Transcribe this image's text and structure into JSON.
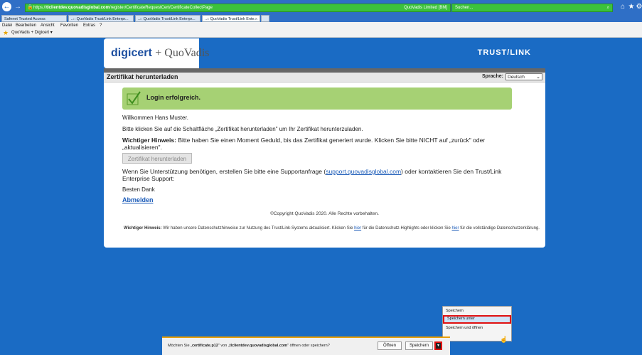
{
  "browser": {
    "url_prefix": "https://",
    "url_domain": "tlclientdev.quovadisglobal.com",
    "url_path": "/register/CertificateRequestCert/CertificateCollectPage",
    "cert_label": "QuoVadis Limited [BM]",
    "search_placeholder": "Suchen...",
    "tabs": [
      {
        "label": "Safenet Trusted Access"
      },
      {
        "label": "..:: QuoVadis Trust/Link Enterpr..."
      },
      {
        "label": "..:: QuoVadis Trust/Link Enterpr..."
      },
      {
        "label": "..:: QuoVadis Trust/Link Ente..."
      }
    ],
    "menu": [
      "Datei",
      "Bearbeiten",
      "Ansicht",
      "Favoriten",
      "Extras",
      "?"
    ],
    "favorite": "QuoVadis + Digicert ▾"
  },
  "header": {
    "logo_main": "digicert",
    "logo_secondary": "+ QuoVadis",
    "brand": "TRUST/LINK"
  },
  "page": {
    "title": "Zertifikat herunterladen",
    "lang_label": "Sprache:",
    "lang_value": "Deutsch",
    "success": "Login erfolgreich.",
    "welcome": "Willkommen Hans Muster.",
    "instruction": "Bitte klicken Sie auf die Schaltfläche „Zertifikat herunterladen\" um Ihr Zertifikat herunterzuladen.",
    "notice_bold": "Wichtiger Hinweis:",
    "notice_text_1": " Bitte haben Sie einen Moment Geduld, bis das Zertifikat generiert wurde. Klicken Sie bitte NICHT auf „zurück\" oder",
    "notice_text_2": "„aktualisieren\".",
    "download_button": "Zertifikat herunterladen",
    "support_1": "Wenn Sie Unterstützung benötigen, erstellen Sie bitte eine Supportanfrage (",
    "support_link": "support.quovadisglobal.com",
    "support_2": ") oder kontaktieren Sie den Trust/Link",
    "support_3": "Enterprise Support:",
    "thanks": "Besten Dank",
    "logout": "Abmelden",
    "copyright": "©Copyright QuoVadis 2020. Alle Rechte vorbehalten.",
    "privacy_bold": "Wichtiger Hinweis:",
    "privacy_1": " Wir haben unsere Datenschutzhinweise zur Nutzung des Trust/Link-Systems aktualisiert. Klicken Sie ",
    "privacy_link1": "hier",
    "privacy_2": " für die Datenschutz-Highlights oder klicken Sie ",
    "privacy_link2": "hier",
    "privacy_3": " für die vollständige Datenschutzerklärung."
  },
  "download_bar": {
    "message_prefix": "Möchten Sie „",
    "filename": "certificate.p12",
    "message_mid": "\" von „",
    "host": "tlclientdev.quovadisglobal.com",
    "message_suffix": "\" öffnen oder speichern?",
    "open": "Öffnen",
    "save": "Speichern",
    "menu": [
      "Speichern",
      "Speichern unter",
      "Speichern und öffnen"
    ]
  }
}
